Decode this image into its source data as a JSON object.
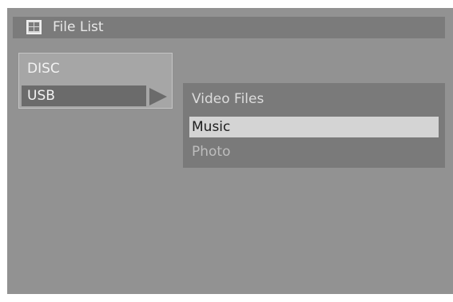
{
  "titlebar": {
    "icon": "file-list-grid-icon",
    "title": "File List"
  },
  "source_menu": {
    "items": [
      {
        "label": "DISC",
        "selected": false
      },
      {
        "label": "USB",
        "selected": true
      }
    ],
    "expand_icon": "triangle-right-icon"
  },
  "file_type_menu": {
    "items": [
      {
        "label": "Video Files",
        "selected": false
      },
      {
        "label": "Music",
        "selected": true
      },
      {
        "label": "Photo",
        "selected": false
      }
    ]
  },
  "colors": {
    "screen_background": "#929292",
    "titlebar_background": "#7b7b7b",
    "highlight": "#d4d4d4",
    "selected_source": "#6b6b6b"
  }
}
